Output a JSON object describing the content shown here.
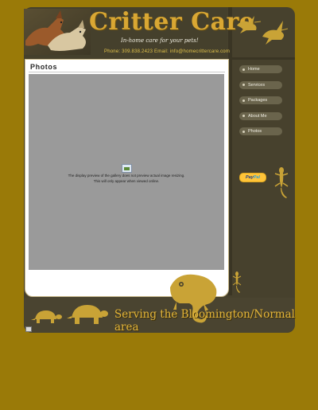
{
  "header": {
    "title": "Critter Care",
    "tagline": "In-home care for your pets!",
    "contact": "Phone: 309.838.2423   Email: info@homecrittercare.com"
  },
  "content": {
    "title": "Photos",
    "gallery_note_line1": "The display preview of the gallery does not preview actual image resizing.",
    "gallery_note_line2": "This will only appear when viewed online."
  },
  "nav": {
    "items": [
      {
        "label": "Home"
      },
      {
        "label": "Services"
      },
      {
        "label": "Packages"
      },
      {
        "label": "About Me"
      },
      {
        "label": "Photos"
      }
    ]
  },
  "paypal": {
    "part1": "Pay",
    "part2": "Pal"
  },
  "footer": {
    "text": "Serving the Bloomington/Normal area"
  },
  "colors": {
    "background": "#9a7a08",
    "panel": "#47412d",
    "accent": "#d9a733",
    "nav_button": "#6a644c"
  },
  "icons": {
    "header_photo": "dogs-photo",
    "header_birds": "hummingbird-silhouettes",
    "gecko": "gecko-silhouette",
    "chameleon": "chameleon-silhouette",
    "turtles": "turtle-silhouettes"
  }
}
